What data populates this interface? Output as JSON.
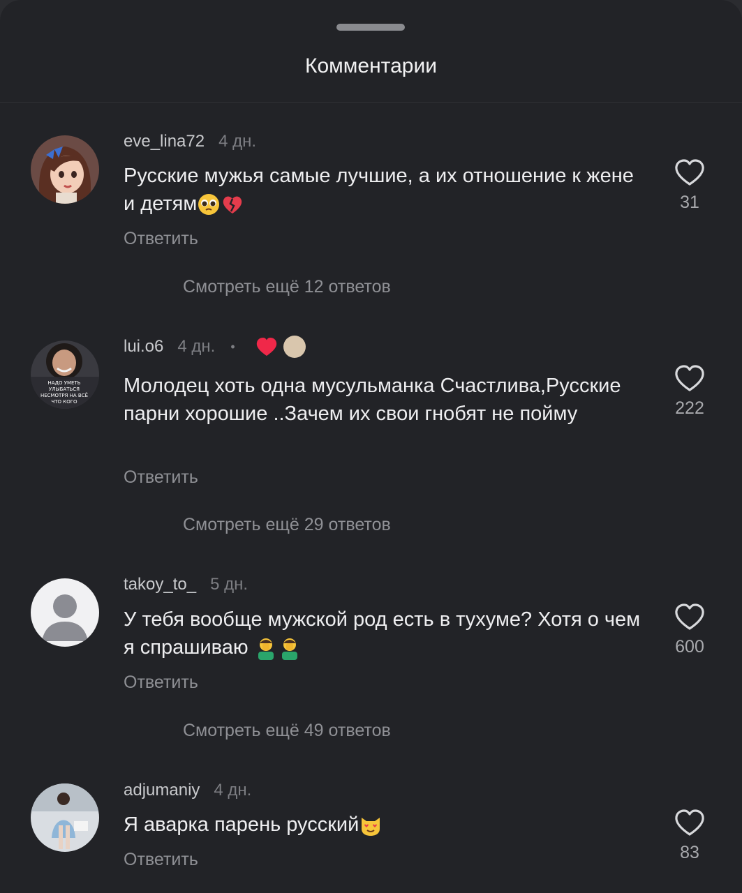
{
  "header": {
    "title": "Комментарии"
  },
  "comments": [
    {
      "username": "eve_lina72",
      "time": "4 дн.",
      "text": "Русские мужья самые лучшие, а их отношение к жене и детям",
      "emojis": [
        "pleading-face",
        "broken-heart"
      ],
      "likes": "31",
      "reply_label": "Ответить",
      "more_label": "Смотреть ещё 12 ответов"
    },
    {
      "username": "lui.o6",
      "time": "4 дн.",
      "separator": "•",
      "text": "Молодец хоть одна мусульманка Счастлива,Русские парни хорошие ..Зачем их свои гнобят не пойму",
      "avatar_text": [
        "НАДО УМЕТЬ",
        "УЛЫБАТЬСЯ",
        "НЕСМОТРЯ НА ВСЁ",
        "ЧТО КОГО"
      ],
      "likes": "222",
      "reply_label": "Ответить",
      "more_label": "Смотреть ещё 29 ответов"
    },
    {
      "username": "takoy_to_",
      "time": "5 дн.",
      "text": "У тебя вообще мужской род есть в тухуме? Хотя о чем я спрашиваю",
      "emojis": [
        "man-facepalming",
        "man-facepalming"
      ],
      "likes": "600",
      "reply_label": "Ответить",
      "more_label": "Смотреть ещё 49 ответов"
    },
    {
      "username": "adjumaniy",
      "time": "4 дн.",
      "text": "Я аварка парень русский",
      "emojis": [
        "heart-eyes-cat"
      ],
      "likes": "83",
      "reply_label": "Ответить"
    }
  ]
}
